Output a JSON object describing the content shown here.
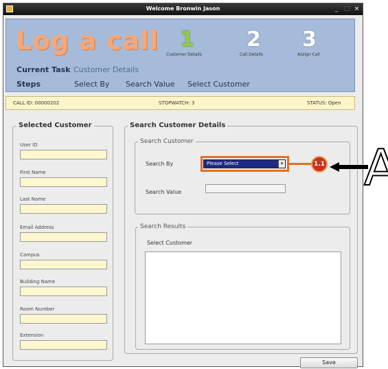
{
  "window": {
    "title": "Welcome Bronwin Jason",
    "minimize": "_",
    "maximize": "□",
    "close": "×"
  },
  "header": {
    "title": "Log a call",
    "steps": [
      {
        "number": "1",
        "caption": "Customer Details",
        "active": true
      },
      {
        "number": "2",
        "caption": "Call Details",
        "active": false
      },
      {
        "number": "3",
        "caption": "Assign Call",
        "active": false
      }
    ],
    "current_task_label": "Current Task",
    "current_task_value": "Customer Details",
    "steps_label": "Steps",
    "step_links": [
      "Select By",
      "Search Value",
      "Select Customer"
    ]
  },
  "infobar": {
    "call_id": "CALL ID:  00000202",
    "stopwatch": "STOPWATCH:  3",
    "status": "STATUS: Open"
  },
  "selected_customer": {
    "legend": "Selected Customer",
    "fields": [
      {
        "label": "User ID",
        "value": ""
      },
      {
        "label": "First Name",
        "value": ""
      },
      {
        "label": "Last Name",
        "value": ""
      },
      {
        "label": "Email Address",
        "value": ""
      },
      {
        "label": "Campus",
        "value": ""
      },
      {
        "label": "Building Name",
        "value": ""
      },
      {
        "label": "Room Number",
        "value": ""
      },
      {
        "label": "Extension",
        "value": ""
      }
    ]
  },
  "search": {
    "legend": "Search Customer Details",
    "sub_legend": "Search Customer",
    "search_by_label": "Search By",
    "search_by_value": "Please Select",
    "search_value_label": "Search Value",
    "search_value": "",
    "results_legend": "Search Results",
    "select_customer_label": "Select Customer"
  },
  "annotation": {
    "badge": "1.1",
    "letter": "A",
    "accent_color": "#e36f1e"
  },
  "footer": {
    "save_label": "Save"
  }
}
